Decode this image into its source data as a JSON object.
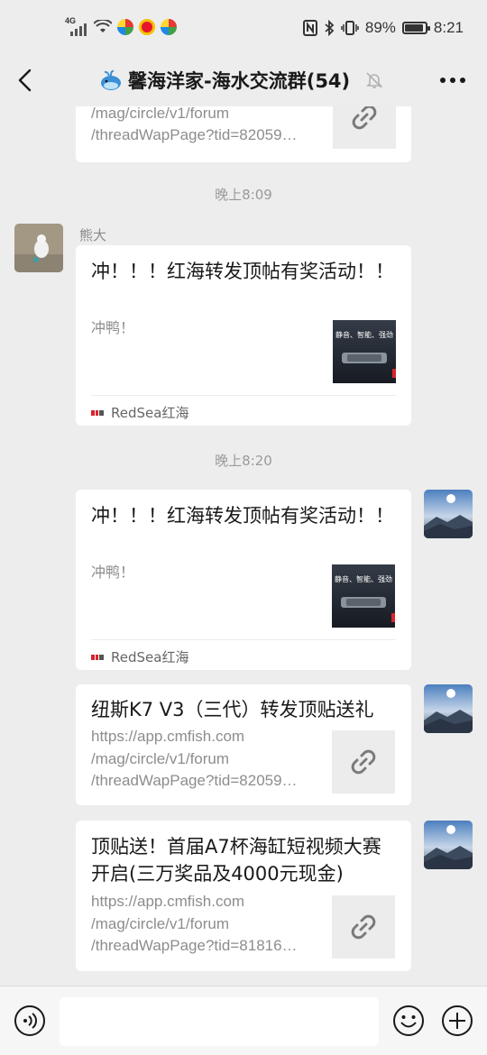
{
  "status_bar": {
    "network": "4G",
    "battery": "89%",
    "battery_level": 0.89,
    "time": "8:21"
  },
  "header": {
    "title": "馨海洋家-海水交流群(54)"
  },
  "chat": {
    "partial_top": {
      "desc_lines": [
        "/mag/circle/v1/forum",
        "/threadWapPage?tid=82059…"
      ]
    },
    "time_1": "晚上8:09",
    "msg_1": {
      "sender": "熊大",
      "title": "冲！！！红海转发顶帖有奖活动！！",
      "desc": "冲鸭！",
      "source": "RedSea红海",
      "thumb_text": "静音、智能、强劲"
    },
    "time_2": "晚上8:20",
    "msg_2": {
      "title": "冲！！！红海转发顶帖有奖活动！！",
      "desc": "冲鸭！",
      "source": "RedSea红海",
      "thumb_text": "静音、智能、强劲"
    },
    "msg_3": {
      "title": "纽斯K7 V3（三代）转发顶贴送礼",
      "desc_lines": [
        "https://app.cmfish.com",
        "/mag/circle/v1/forum",
        "/threadWapPage?tid=82059…"
      ]
    },
    "msg_4": {
      "title": "顶贴送！首届A7杯海缸短视频大赛开启(三万奖品及4000元现金)",
      "desc_lines": [
        "https://app.cmfish.com",
        "/mag/circle/v1/forum",
        "/threadWapPage?tid=81816…"
      ]
    }
  },
  "input_bar": {
    "placeholder": ""
  },
  "colors": {
    "background": "#ededed",
    "bubble": "#ffffff",
    "secondary_text": "#8d8d8d",
    "accent_red": "#d9242b"
  }
}
